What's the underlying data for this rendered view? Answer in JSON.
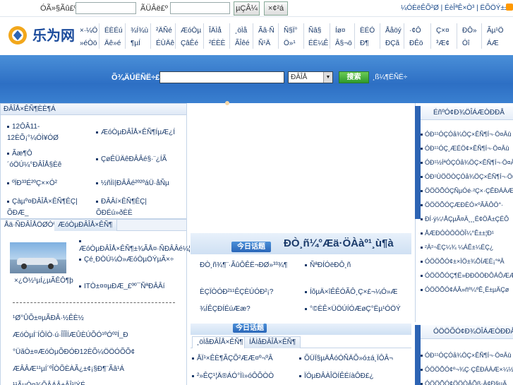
{
  "topbar": {
    "username_label": "ÓÃ»§Ãû£º",
    "password_label": "ÃÜÂë£º",
    "login_button": "µÇÂ¼",
    "register_button": "×¢²á",
    "links": "¼ÓÈëÊÕ²Ø | ÉèÎªÊ×Ò³ | ËÕÖÝ±±¼"
  },
  "logo": {
    "text": "乐为网"
  },
  "nav": [
    {
      "top": "×·¼Ó",
      "bottom": "»éÒö"
    },
    {
      "top": "ÉÈÉú",
      "bottom": "Äê»é"
    },
    {
      "top": "¾Í¾ù",
      "bottom": "¶µÍ"
    },
    {
      "top": "²ÄÑé",
      "bottom": "ÉÙÄê"
    },
    {
      "top": "ÆóÒµ",
      "bottom": "ÇâÊé"
    },
    {
      "top": "ÎÄÌå",
      "bottom": "²ÉÈÈ"
    },
    {
      "top": "¸öÌå",
      "bottom": "ÃÎêé"
    },
    {
      "top": "Ãâ·Ñ",
      "bottom": "Ñ¹Ä"
    },
    {
      "top": "Ñ§Ï°",
      "bottom": "Ö»¹"
    },
    {
      "top": "Ñâ§",
      "bottom": "ÉË¼Ê"
    },
    {
      "top": "Íø¤",
      "bottom": "Â§¬ö"
    },
    {
      "top": "ÈÉÓ",
      "bottom": "Ð¶"
    },
    {
      "top": "Ååöý",
      "bottom": "ÐÇã"
    },
    {
      "top": "·¢Ô",
      "bottom": "ÐÊö"
    },
    {
      "top": "Ç×¤",
      "bottom": "³Æ¢"
    },
    {
      "top": "ÐÔ»",
      "bottom": "Óî"
    },
    {
      "top": "Ãµ¹Ö",
      "bottom": "ÁÆ"
    }
  ],
  "search": {
    "label": "Õ¾ÄÚËÑË÷£º",
    "placeholder": "",
    "category": "ÐÂÎÅ",
    "button": "搜索",
    "advanced": "¸ß¼¶ËÑË÷"
  },
  "left_panel": {
    "title": "ÐÂÎÅ×ÊÑ¶ÈÈ¶Á",
    "items": [
      "12ÔÂ11-12ÈÕ¡°¼ÓÌ¥ÓØ",
      "ÆóÒµÐÂÎÅ×ÊÑ¶ÍµÆ¿Í",
      "Ãæ¶Ô´óÖÚ¼°ÐÂÎÅ§Èê",
      "ÇøÊÜÄêÐÂÂé§·¨¿ÍÃ",
      "ºÏÐ³³É²ºÇ××Ó²",
      "½ñÌì|ÐÂÂé²º²ºáÜ·åÑµ",
      "Çàµº¤ÐÂÎÅ×ÊÑ¶ÊÇ|ÕÐÆ_",
      "ÐÂÂí×ÊÑ¶ÊÇ|ÕÐÉú»ðÈÈ"
    ]
  },
  "left_tabs": [
    "Åä·ÑÐÂÎÅÖØÒª",
    "ÆóÒµÐÂÎÅ×ÊÑ¶"
  ],
  "left_body": {
    "caption": "×¿Ö½¹µÍ¿µÃÊÔ¶þ",
    "side_items": [
      "ÆóÒµÐÂÎÅ×ÊÑ¶±¾ÃÅ¤·ÑÐÂÂé¼¦",
      "Çé¸ÐÒÚ¼Ò»ÆóÒµÖÝµÃ×÷",
      "ITÒ±¤¤µÐÆ_£ºº¯ÑªÐÂÂí"
    ],
    "list": [
      "¹Ø°ÛÕ±¤µÃÐÂ·½ÊÈ½",
      "ÆóÒµÍ¨ÍÔÏÒ·ú·ÎÎÎÍÆÛÈÚÕÓ¹ºÓº²Í_Ð",
      "°ÜãÒ±¤ÆóÒµÕÐÓÐ12ÈÕ¼ÖÖÓÕÕ¢",
      "ÆÂÂÆ¹¹µÍ´ºÎÒÕÈÀÃ¿±¢¡§Ð¶¨Ãâ¹Á",
      "¹¹ÃµÒ¤¾ÕÂÁÂ±ÂÎ¹¦ÝÉ"
    ]
  },
  "center": {
    "badge": "今日话题",
    "headline": "ÐÒ¸ñ¼°Æä·ÖÀàº¹¸ù¶à",
    "items_left": [
      "ÐÒ¸ñ¾¶¨·ÃûÔÊË¬ÐØ»³³¾¶",
      "ÈÇÏÒÓÐ²¹¹ÊÇÈÚÓÐ²¡?",
      "¾ÍÊÇÐÍÉúÆæ?"
    ],
    "items_right": [
      "ÑªÐÍÓëÐÔ¸ñ",
      "ÍõµÄ×îÊÊÓÃÔ¸Ç×£¬¼Ó»Æ",
      "°©ÈÊ×ÜÖÚÍÓÆøÇ°Ëµ¹ÓÖÝ"
    ],
    "badge2": "今日话题",
    "tabs": [
      "¸öÌåÐÂÎÅ×ÊÑ¶",
      "ÍÅÌåÐÂÎÅ×ÊÑ¶"
    ],
    "bottom_left": [
      "ÅÏ¹×ÊÈ¶ÃÇÕ²ÆÆ¤º¬ºÂ",
      "²»ÊÇ¹¦Ä®ÁÓ°Ìì»óÔÕÒÒ"
    ],
    "bottom_right": [
      "ÕÜÏ§µÄÅóÓÑÄÕ»ó±á¸ÏÔÂ¬",
      "ÏÓµÐÂÀÎÖÍÊÉíàÔÐ£¿"
    ]
  },
  "right_panel": {
    "title": "ÉñºÓ¢Ð¾ÖÎÁÆÒÐÐÅ",
    "items": [
      "ÓÐ¹¹ÓÇÓå¾ÖÇ×ÊÑ¶Í¬·Ö¤Âû",
      "ÓÐ¹¹ÓÇ¸ÆÉÖ¢×ÊÑ¶Í¬·Ö¤Âû",
      "ÓÐ¹½ÍªÓÇÓå¾ÖÇ×ÊÑ¶Í¬·Ö¤Âû",
      "ÓÐ¹ÙÖÖÒÇÓå¾ÖÇ×ÊÑ¶Í¬·Ö¤Âû",
      "ÖÖÖÕÓÇÑµÓé·²Ç×·ÇÊÐÁÀÆ×¼½",
      "ÖÖÖÕÓÇÆÐÈÓ×ºÃÂÔÖ°·",
      "ÐÍ·ý¼¹ÅÇµÃ¤Ä¸¸¸É¢ÖÅ±ÇÉÔ",
      "ÅÆÐÓÒÖÖÒÎ¼°Ê±±¦Ð¹",
      "²Ä²¬ÈÇ¼¾ ¼ÁÊ±¼ÉÇ¿",
      "ÓÖÖÕÓ¢±×ÌÖ±¾ÕÍÆÈ¡°ªÂ",
      "ÓÖÖÕÓÇ¶Ë»ÐÐÖÖÐÔÁÔÆÆ",
      "ÓÖÖÕÓ¢ÁÂ»ñº¼ºÊ¸Ë±µÄÇø"
    ],
    "title2": "ÓÖÖÕÓ¢Ð¾ÖÎÁÆÒÐÐÅ",
    "items2": [
      "ÓÐ¹¹ÓÇÓå¾ÖÇ×ÊÑ¶Í¬·Ö¤Âû",
      "ÓÖÖÕÓ¢º¬¾Ç·ÇÊÐÁÀÆ×¼½",
      "ÓÖÖÕÓ¢ÖÖÒÂÕß·À¢Ð§µÄ"
    ]
  },
  "colors": {
    "banner": "#2d6fc4",
    "accent": "#2d64b4",
    "search_button": "#2f9a2b"
  }
}
